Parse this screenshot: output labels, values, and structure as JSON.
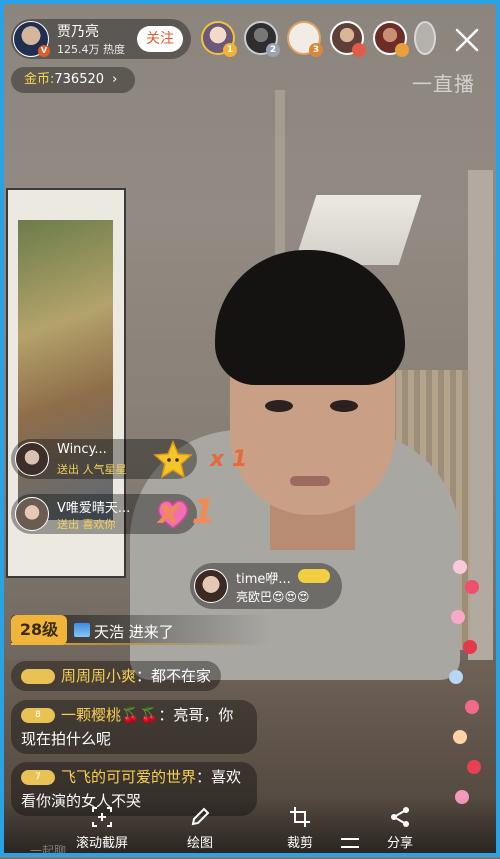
{
  "host": {
    "name": "贾乃亮",
    "heat": "125.4万 热度",
    "verified_badge": "V",
    "follow_label": "关注"
  },
  "viewers": [
    {
      "rank": "1",
      "rank_color": "#f2b233"
    },
    {
      "rank": "2",
      "rank_color": "#9aa4b1"
    },
    {
      "rank": "3",
      "rank_color": "#d9873a"
    },
    {
      "rank": "",
      "rank_color": "#e25b4a"
    },
    {
      "rank": "",
      "rank_color": "#e8a03b"
    }
  ],
  "coins": {
    "label": "金币:",
    "value": "736520",
    "arrow": "›"
  },
  "watermark": "一直播",
  "gifts": [
    {
      "name": "Wincy...",
      "desc": "送出 人气星星",
      "count": "x 1",
      "icon": "star-icon"
    },
    {
      "name": "V唯爱晴天...",
      "desc": "送出 喜欢你",
      "count": "x 1",
      "icon": "heart-icon"
    }
  ],
  "floating_comment": {
    "name": "time咿...",
    "text": "亮欧巴😍😍😍"
  },
  "entry": {
    "level": "28级",
    "text": "天浩 进来了"
  },
  "chat": [
    {
      "level": "",
      "name": "周周周小爽",
      "text": "：都不在家"
    },
    {
      "level": "8",
      "name": "一颗樱桃🍒🍒",
      "text": "：亮哥，你",
      "text2": "现在拍什么呢"
    },
    {
      "level": "7",
      "name": "飞飞的可可爱的世界",
      "text": "：喜欢",
      "text2": "看你演的女人不哭"
    }
  ],
  "toolbar": [
    {
      "label": "滚动截屏",
      "icon": "scroll-screenshot-icon"
    },
    {
      "label": "绘图",
      "icon": "pencil-icon"
    },
    {
      "label": "裁剪",
      "icon": "crop-icon"
    },
    {
      "label": "分享",
      "icon": "share-icon"
    }
  ],
  "bottom_hint": "一起聊...",
  "colors": {
    "frame": "#27a3e6",
    "accent_orange": "#e45a2e",
    "gold": "#f2ce42"
  }
}
